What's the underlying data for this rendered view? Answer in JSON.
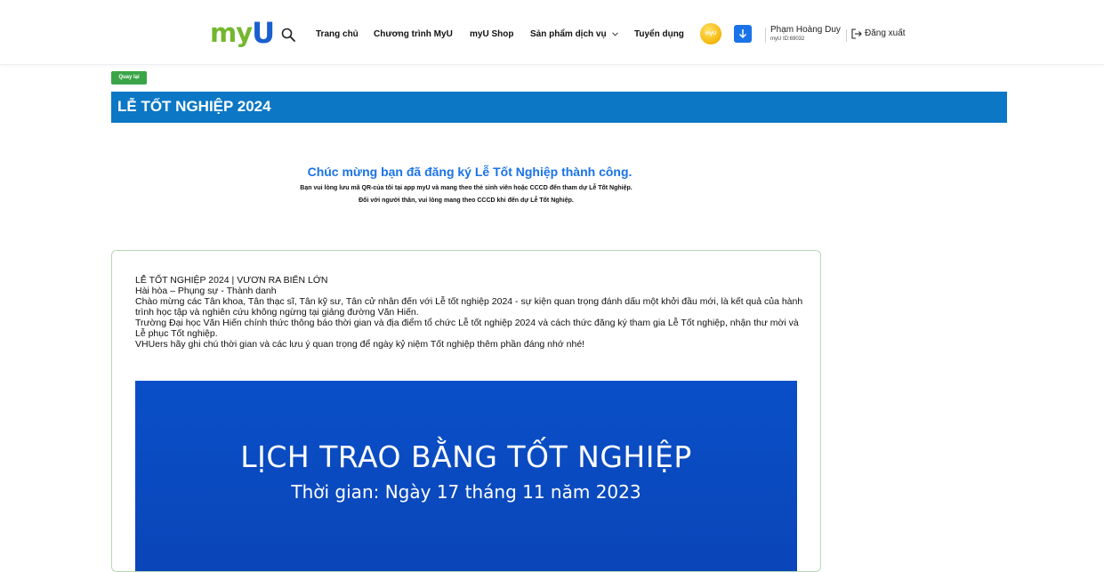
{
  "colors": {
    "brand_green": "#74b72e",
    "brand_blue": "#1a5fd0",
    "title_bar": "#0b77c5",
    "back_button": "#3aa548",
    "success_text": "#1a73e8",
    "banner": "#0a4fc8"
  },
  "header": {
    "logo": {
      "part1": "my",
      "part2": "U"
    },
    "search_icon": "search-icon",
    "nav": {
      "home": "Trang chủ",
      "program": "Chương trình MyU",
      "shop": "myU Shop",
      "products": "Sản phẩm dịch vụ",
      "careers": "Tuyển dụng"
    },
    "coin_label": "myU",
    "download_icon": "arrow-down-icon",
    "user": {
      "name": "Phạm Hoàng Duy",
      "id": "myU ID:69032"
    },
    "logout_label": "Đăng xuất"
  },
  "back_button": "Quay lại",
  "page_title": "LỄ TỐT NGHIỆP 2024",
  "success": {
    "heading": "Chúc mừng bạn đã đăng ký Lễ Tốt Nghiệp thành công.",
    "line1": "Bạn vui lòng lưu mã QR-của tôi tại app myU và mang theo thẻ sinh viên hoặc CCCD đến tham dự Lễ Tốt Nghiệp.",
    "line2": "Đối với người thân, vui lòng mang theo CCCD khi đến dự Lễ Tốt Nghiệp."
  },
  "card": {
    "lines": [
      "LỄ TỐT NGHIỆP 2024 | VƯƠN RA BIỂN LỚN",
      "Hài hòa – Phụng sự - Thành danh",
      "Chào mừng các Tân khoa, Tân thạc sĩ, Tân kỹ sư, Tân cử nhân đến với Lễ tốt nghiệp 2024 - sự kiện quan trọng đánh dấu một khởi đầu mới, là kết quả của hành trình học tập và nghiên cứu không ngừng tại giảng đường Văn Hiến.",
      "Trường Đại học Văn Hiến chính thức thông báo thời gian và địa điểm tổ chức Lễ tốt nghiệp 2024 và cách thức đăng ký tham gia Lễ Tốt nghiệp, nhận thư mời và Lễ phục Tốt nghiệp.",
      "VHUers hãy ghi chú thời gian và các lưu ý quan trọng để ngày kỷ niệm Tốt nghiệp thêm phần đáng nhớ nhé!"
    ],
    "banner": {
      "title": "LỊCH TRAO BẰNG TỐT NGHIỆP",
      "subtitle": "Thời gian: Ngày 17 tháng 11 năm 2023"
    }
  }
}
